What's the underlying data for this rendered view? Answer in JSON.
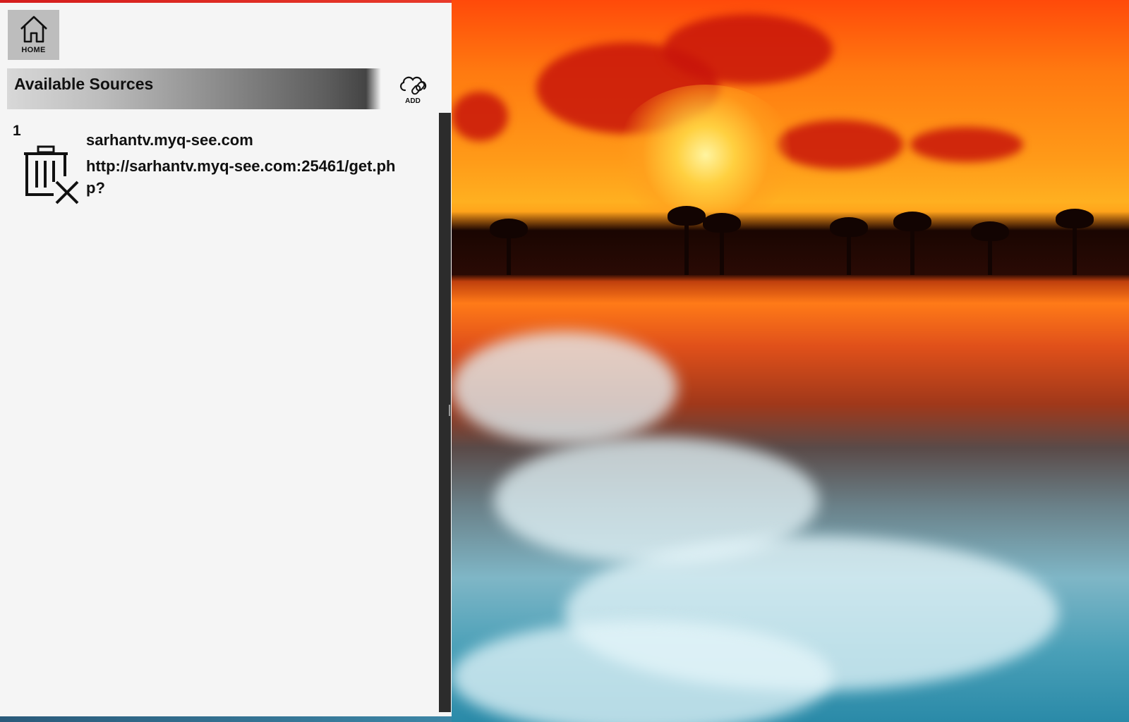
{
  "nav": {
    "home_label": "HOME"
  },
  "sources_header": {
    "title": "Available Sources",
    "add_label": "ADD"
  },
  "sources": [
    {
      "index": "1",
      "name": "sarhantv.myq-see.com",
      "url": "http://sarhantv.myq-see.com:25461/get.php?"
    }
  ],
  "icons": {
    "home": "home-icon",
    "add": "cloud-link-icon",
    "delete": "trash-x-icon"
  },
  "colors": {
    "panel_bg": "#f5f5f5",
    "home_button_bg": "#bdbdbd",
    "scrollbar": "#2c2c2c",
    "accent_top": "#d41c1c"
  }
}
